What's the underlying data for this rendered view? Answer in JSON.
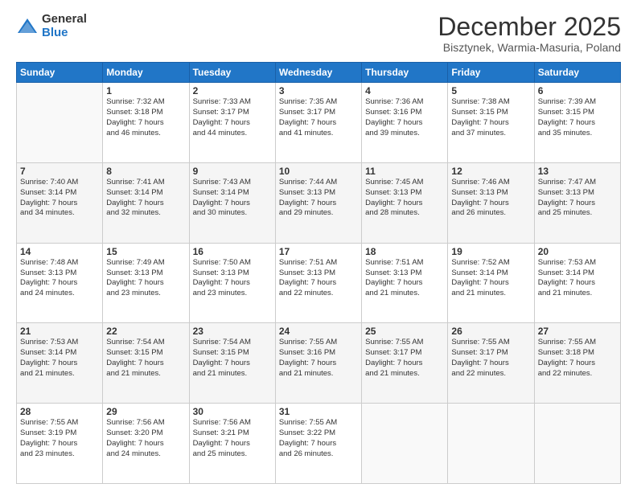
{
  "header": {
    "logo_general": "General",
    "logo_blue": "Blue",
    "title": "December 2025",
    "subtitle": "Bisztynek, Warmia-Masuria, Poland"
  },
  "calendar": {
    "days_of_week": [
      "Sunday",
      "Monday",
      "Tuesday",
      "Wednesday",
      "Thursday",
      "Friday",
      "Saturday"
    ],
    "weeks": [
      [
        {
          "day": "",
          "info": ""
        },
        {
          "day": "1",
          "info": "Sunrise: 7:32 AM\nSunset: 3:18 PM\nDaylight: 7 hours\nand 46 minutes."
        },
        {
          "day": "2",
          "info": "Sunrise: 7:33 AM\nSunset: 3:17 PM\nDaylight: 7 hours\nand 44 minutes."
        },
        {
          "day": "3",
          "info": "Sunrise: 7:35 AM\nSunset: 3:17 PM\nDaylight: 7 hours\nand 41 minutes."
        },
        {
          "day": "4",
          "info": "Sunrise: 7:36 AM\nSunset: 3:16 PM\nDaylight: 7 hours\nand 39 minutes."
        },
        {
          "day": "5",
          "info": "Sunrise: 7:38 AM\nSunset: 3:15 PM\nDaylight: 7 hours\nand 37 minutes."
        },
        {
          "day": "6",
          "info": "Sunrise: 7:39 AM\nSunset: 3:15 PM\nDaylight: 7 hours\nand 35 minutes."
        }
      ],
      [
        {
          "day": "7",
          "info": "Sunrise: 7:40 AM\nSunset: 3:14 PM\nDaylight: 7 hours\nand 34 minutes."
        },
        {
          "day": "8",
          "info": "Sunrise: 7:41 AM\nSunset: 3:14 PM\nDaylight: 7 hours\nand 32 minutes."
        },
        {
          "day": "9",
          "info": "Sunrise: 7:43 AM\nSunset: 3:14 PM\nDaylight: 7 hours\nand 30 minutes."
        },
        {
          "day": "10",
          "info": "Sunrise: 7:44 AM\nSunset: 3:13 PM\nDaylight: 7 hours\nand 29 minutes."
        },
        {
          "day": "11",
          "info": "Sunrise: 7:45 AM\nSunset: 3:13 PM\nDaylight: 7 hours\nand 28 minutes."
        },
        {
          "day": "12",
          "info": "Sunrise: 7:46 AM\nSunset: 3:13 PM\nDaylight: 7 hours\nand 26 minutes."
        },
        {
          "day": "13",
          "info": "Sunrise: 7:47 AM\nSunset: 3:13 PM\nDaylight: 7 hours\nand 25 minutes."
        }
      ],
      [
        {
          "day": "14",
          "info": "Sunrise: 7:48 AM\nSunset: 3:13 PM\nDaylight: 7 hours\nand 24 minutes."
        },
        {
          "day": "15",
          "info": "Sunrise: 7:49 AM\nSunset: 3:13 PM\nDaylight: 7 hours\nand 23 minutes."
        },
        {
          "day": "16",
          "info": "Sunrise: 7:50 AM\nSunset: 3:13 PM\nDaylight: 7 hours\nand 23 minutes."
        },
        {
          "day": "17",
          "info": "Sunrise: 7:51 AM\nSunset: 3:13 PM\nDaylight: 7 hours\nand 22 minutes."
        },
        {
          "day": "18",
          "info": "Sunrise: 7:51 AM\nSunset: 3:13 PM\nDaylight: 7 hours\nand 21 minutes."
        },
        {
          "day": "19",
          "info": "Sunrise: 7:52 AM\nSunset: 3:14 PM\nDaylight: 7 hours\nand 21 minutes."
        },
        {
          "day": "20",
          "info": "Sunrise: 7:53 AM\nSunset: 3:14 PM\nDaylight: 7 hours\nand 21 minutes."
        }
      ],
      [
        {
          "day": "21",
          "info": "Sunrise: 7:53 AM\nSunset: 3:14 PM\nDaylight: 7 hours\nand 21 minutes."
        },
        {
          "day": "22",
          "info": "Sunrise: 7:54 AM\nSunset: 3:15 PM\nDaylight: 7 hours\nand 21 minutes."
        },
        {
          "day": "23",
          "info": "Sunrise: 7:54 AM\nSunset: 3:15 PM\nDaylight: 7 hours\nand 21 minutes."
        },
        {
          "day": "24",
          "info": "Sunrise: 7:55 AM\nSunset: 3:16 PM\nDaylight: 7 hours\nand 21 minutes."
        },
        {
          "day": "25",
          "info": "Sunrise: 7:55 AM\nSunset: 3:17 PM\nDaylight: 7 hours\nand 21 minutes."
        },
        {
          "day": "26",
          "info": "Sunrise: 7:55 AM\nSunset: 3:17 PM\nDaylight: 7 hours\nand 22 minutes."
        },
        {
          "day": "27",
          "info": "Sunrise: 7:55 AM\nSunset: 3:18 PM\nDaylight: 7 hours\nand 22 minutes."
        }
      ],
      [
        {
          "day": "28",
          "info": "Sunrise: 7:55 AM\nSunset: 3:19 PM\nDaylight: 7 hours\nand 23 minutes."
        },
        {
          "day": "29",
          "info": "Sunrise: 7:56 AM\nSunset: 3:20 PM\nDaylight: 7 hours\nand 24 minutes."
        },
        {
          "day": "30",
          "info": "Sunrise: 7:56 AM\nSunset: 3:21 PM\nDaylight: 7 hours\nand 25 minutes."
        },
        {
          "day": "31",
          "info": "Sunrise: 7:55 AM\nSunset: 3:22 PM\nDaylight: 7 hours\nand 26 minutes."
        },
        {
          "day": "",
          "info": ""
        },
        {
          "day": "",
          "info": ""
        },
        {
          "day": "",
          "info": ""
        }
      ]
    ]
  }
}
